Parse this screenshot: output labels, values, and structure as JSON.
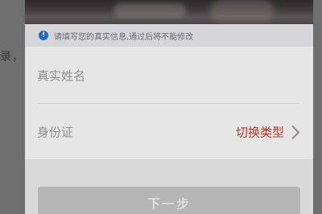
{
  "backdrop": {
    "text": "录，"
  },
  "notice": {
    "icon": "info-icon",
    "icon_glyph": "!",
    "text": "请填写您的真实信息,通过后将不能修改"
  },
  "form": {
    "name_label": "真实姓名",
    "id_label": "身份证",
    "switch_type_label": "切换类型",
    "chevron_icon": "chevron-right-icon"
  },
  "footer": {
    "next_button_label": "下一步"
  },
  "colors": {
    "accent_red": "#b23a2c",
    "info_blue": "#1d6ad6",
    "button_disabled": "#b5b5b5"
  }
}
